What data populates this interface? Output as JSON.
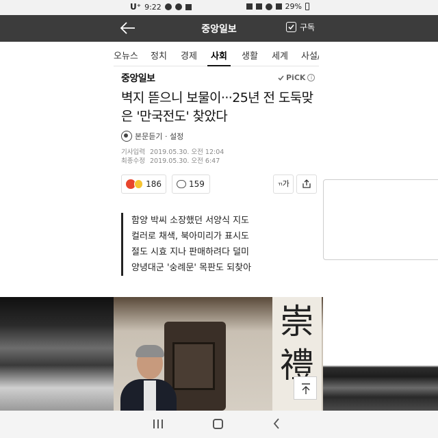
{
  "status_bar": {
    "carrier": "U⁺",
    "time": "9:22",
    "battery": "29%"
  },
  "header": {
    "title": "중앙일보",
    "subscribe_label": "구독",
    "icons": {
      "back": "arrow-left-icon",
      "subscribe": "checkbox-icon"
    }
  },
  "nav": {
    "items": [
      {
        "label": "오뉴스",
        "active": false
      },
      {
        "label": "정치",
        "active": false
      },
      {
        "label": "경제",
        "active": false
      },
      {
        "label": "사회",
        "active": true
      },
      {
        "label": "생활",
        "active": false
      },
      {
        "label": "세계",
        "active": false
      },
      {
        "label": "사설/칼",
        "active": false
      }
    ]
  },
  "article": {
    "publisher": "중앙일보",
    "pick_label": "PiCK",
    "headline": "벽지 뜯으니 보물이···25년 전 도둑맞은 '만국전도' 찾았다",
    "tts_label": "본문듣기 · 설정",
    "dates": {
      "published_label": "기사입력",
      "published": "2019.05.30. 오전 12:04",
      "modified_label": "최종수정",
      "modified": "2019.05.30. 오전 6:47"
    },
    "reaction_count": "186",
    "comment_count": "159",
    "font_size_label": "가",
    "summary": [
      "함양 박씨 소장했던 서양식 지도",
      "컬러로 채색, 북아미리가 표시도",
      "절도 시효 지나 판매하려다 덜미",
      "양녕대군 '숭례문' 목판도 되찾아"
    ],
    "photo_banner_text": "崇禮"
  },
  "colors": {
    "header_bg": "#3c3c3c",
    "accent": "#111111"
  }
}
